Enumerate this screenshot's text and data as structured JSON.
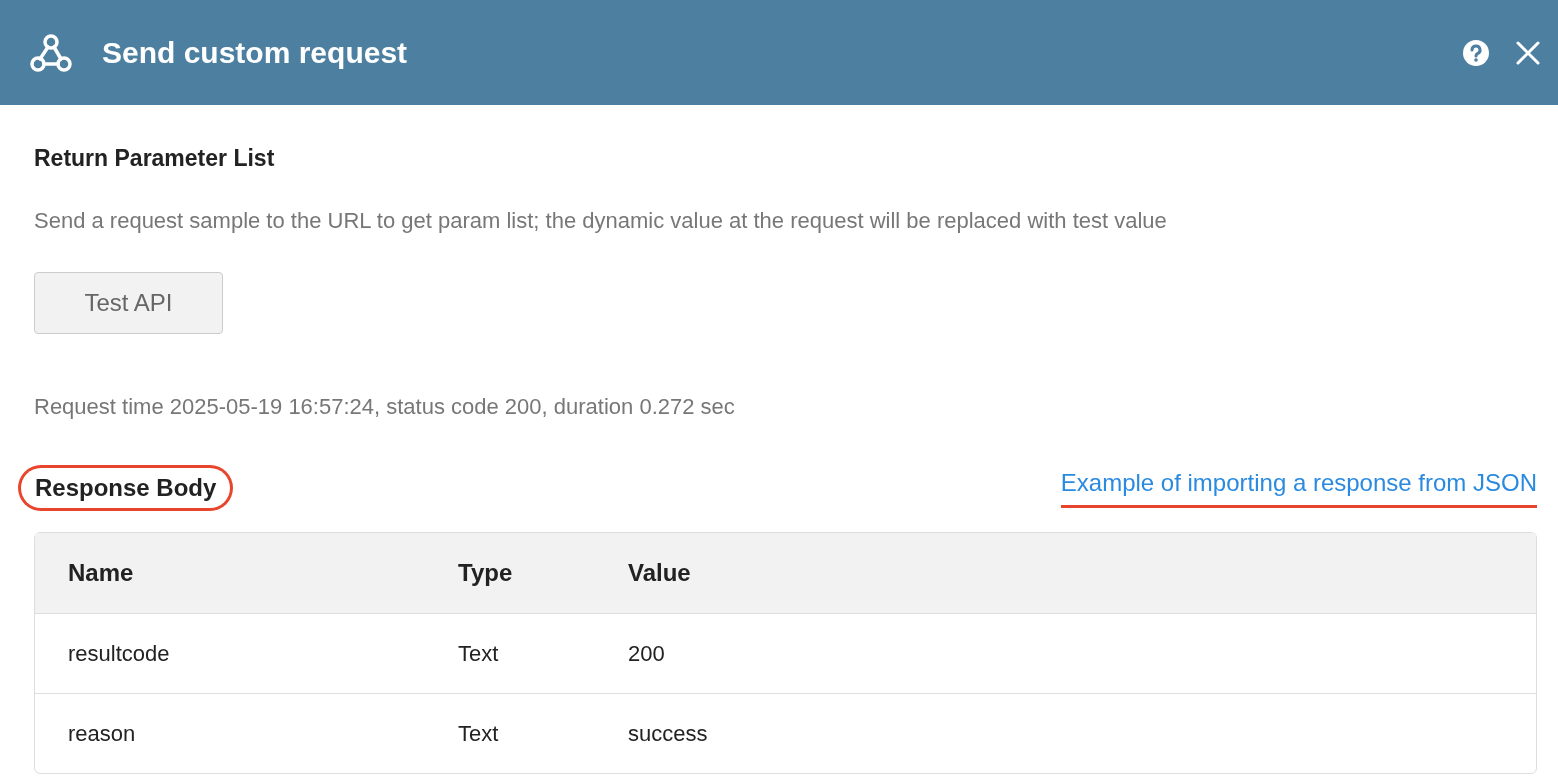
{
  "window": {
    "title": "Send custom request"
  },
  "section": {
    "title": "Return Parameter List",
    "description": "Send a request sample to the URL to get param list; the dynamic value at the request will be replaced with test value",
    "button": "Test API",
    "request_info": "Request time 2025-05-19 16:57:24, status code 200, duration 0.272 sec"
  },
  "response_body": {
    "title": "Response Body",
    "title_circled": true,
    "link": "Example of importing a response from JSON",
    "link_underlined": true
  },
  "table": {
    "columns": [
      "Name",
      "Type",
      "Value"
    ],
    "rows": [
      [
        "resultcode",
        "Text",
        "200"
      ],
      [
        "reason",
        "Text",
        "success"
      ]
    ]
  }
}
